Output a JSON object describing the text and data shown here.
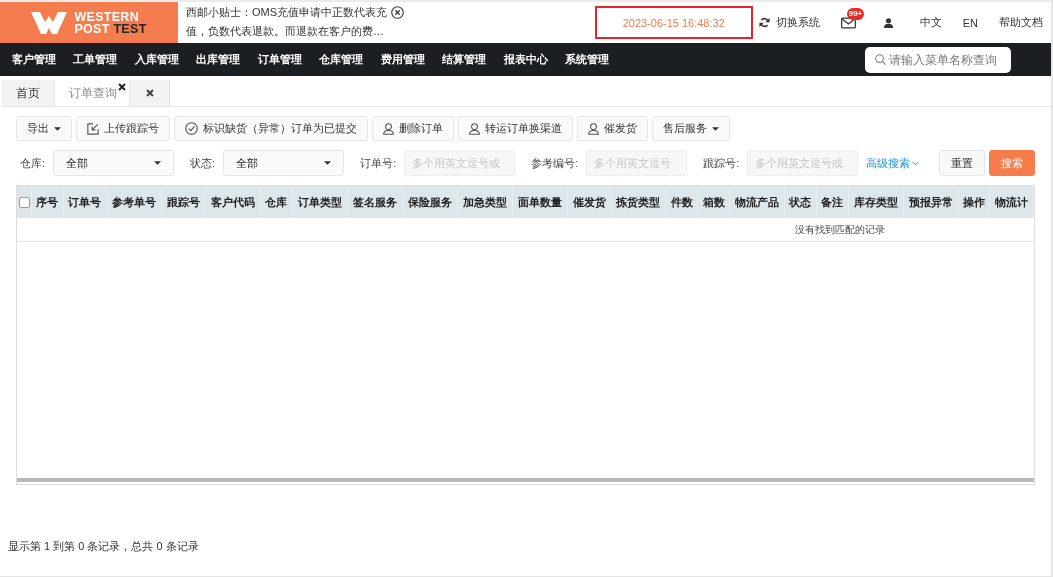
{
  "header": {
    "logo": {
      "line1": "WESTERN",
      "line2": "POST",
      "line2_accent": "TEST"
    },
    "notice": "西邮小贴士：OMS充值申请中正数代表充值，负数代表退款。而退款在客户的费…",
    "datetime": "2023-06-15 16:48:32",
    "switch_system": "切换系统",
    "mail_badge": "99+",
    "languages": [
      "中文",
      "EN"
    ],
    "help": "帮助文档"
  },
  "nav": {
    "items": [
      "客户管理",
      "工单管理",
      "入库管理",
      "出库管理",
      "订单管理",
      "仓库管理",
      "费用管理",
      "结算管理",
      "报表中心",
      "系统管理"
    ],
    "search": {
      "placeholder": "请输入菜单名称查询"
    }
  },
  "tabs": [
    {
      "kind": "page",
      "label": "首页",
      "selected": false,
      "closable": false
    },
    {
      "kind": "page",
      "label": "订单查询",
      "selected": true,
      "closable": true
    },
    {
      "kind": "close-all",
      "selected": false
    }
  ],
  "toolbar": [
    {
      "kind": "menu",
      "label": "导出"
    },
    {
      "kind": "upload",
      "label": "上传跟踪号"
    },
    {
      "kind": "confirm",
      "label": "标识缺货（异常）订单为已提交"
    },
    {
      "kind": "person",
      "label": "删除订单"
    },
    {
      "kind": "person",
      "label": "转运订单换渠道"
    },
    {
      "kind": "person",
      "label": "催发货"
    },
    {
      "kind": "menu",
      "label": "售后服务"
    }
  ],
  "filters": [
    {
      "kind": "select",
      "label": "仓库:",
      "value": "全部"
    },
    {
      "kind": "select",
      "label": "状态:",
      "value": "全部"
    },
    {
      "kind": "input",
      "label": "订单号:",
      "placeholder": "多个用英文逗号或"
    },
    {
      "kind": "input",
      "label": "参考编号:",
      "placeholder": "多个用英文逗号"
    },
    {
      "kind": "input",
      "label": "跟踪号:",
      "placeholder": "多个用英文逗号或"
    }
  ],
  "advanced_search": "高级搜索",
  "buttons": [
    {
      "kind": "reset",
      "label": "重置"
    },
    {
      "kind": "primary",
      "label": "搜索"
    }
  ],
  "table": {
    "select_all": {
      "checked": false
    },
    "columns": [
      "序号",
      "订单号",
      "参考单号",
      "跟踪号",
      "客户代码",
      "仓库",
      "订单类型",
      "签名服务",
      "保险服务",
      "加急类型",
      "面单数量",
      "催发货",
      "拣货类型",
      "件数",
      "箱数",
      "物流产品",
      "状态",
      "备注",
      "库存类型",
      "预报异常",
      "操作",
      "物流计"
    ],
    "empty_message": "没有找到匹配的记录"
  },
  "footer": "显示第 1 到第 0 条记录，总共 0 条记录"
}
